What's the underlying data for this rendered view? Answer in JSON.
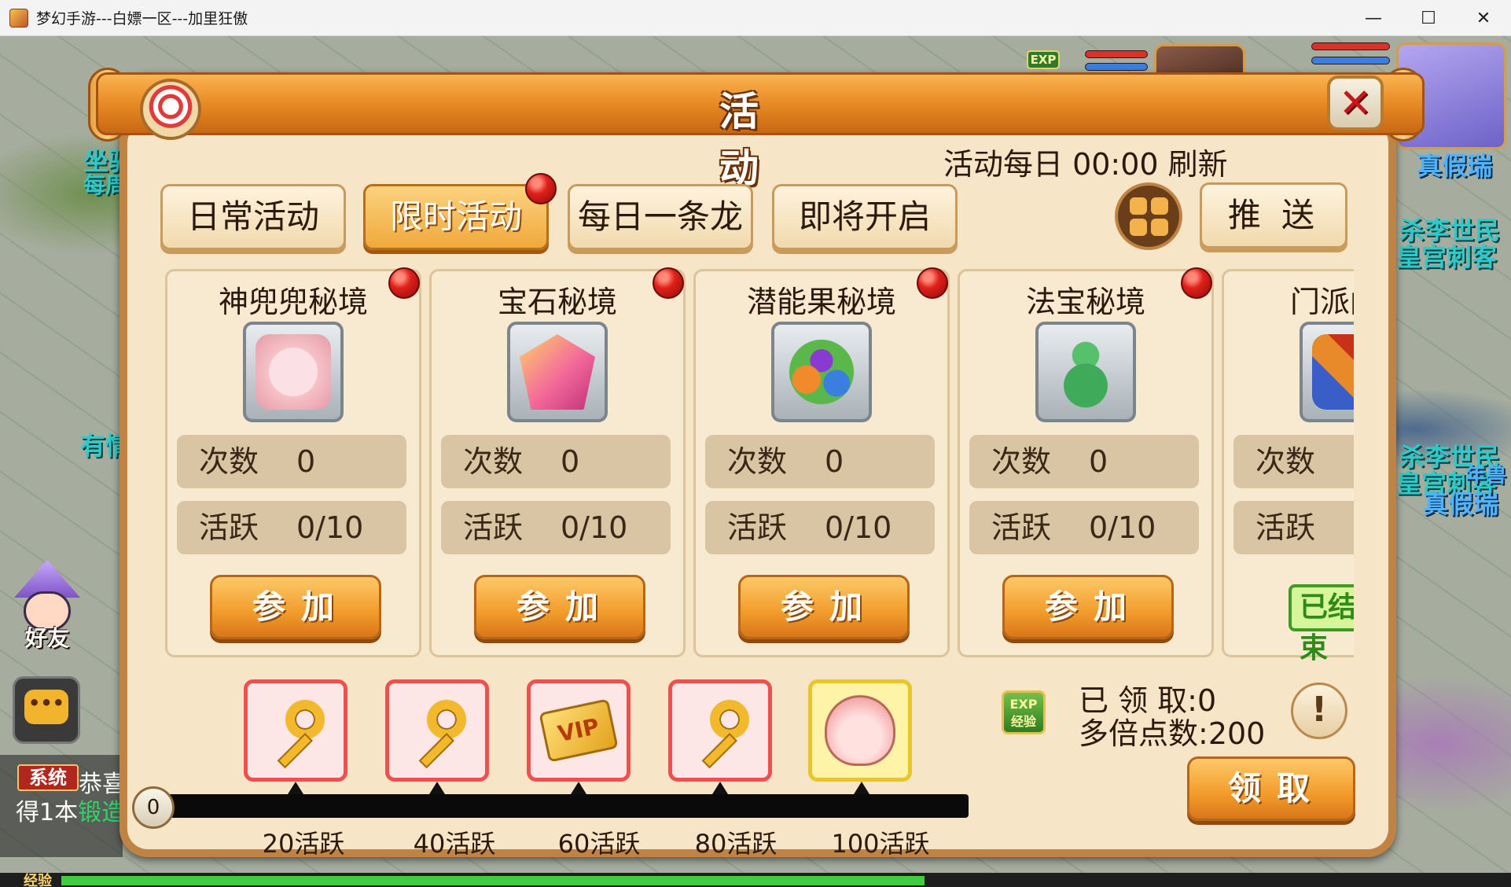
{
  "window": {
    "title": "梦幻手游---白嫖一区---加里狂傲",
    "minimize": "—",
    "maximize": "☐",
    "close": "✕"
  },
  "background": {
    "left_texts": [
      "坐骑",
      "每周",
      "有情"
    ],
    "right_texts": [
      "真假瑞",
      "杀李世民",
      "皇宫刺客",
      "杀李世民",
      "皇宫刺客",
      "真假瑞",
      "年兽"
    ],
    "exp_badge": "EXP",
    "friend_label": "好友",
    "chat_icon": "•••",
    "system_tag": "系统",
    "chat_line1": "恭喜",
    "chat_line2_prefix": "得1本",
    "chat_line2_highlight": "锻造",
    "exp_bar_label": "经验",
    "exp_fraction": 0.6
  },
  "panel": {
    "title": "活 动",
    "refresh_note": "活动每日 00:00 刷新",
    "close_icon": "✕",
    "tabs": [
      {
        "label": "日常活动",
        "active": false,
        "dot": false
      },
      {
        "label": "限时活动",
        "active": true,
        "dot": true
      },
      {
        "label": "每日一条龙",
        "active": false,
        "dot": false
      },
      {
        "label": "即将开启",
        "active": false,
        "dot": false
      }
    ],
    "push_label": "推送"
  },
  "activities": [
    {
      "name": "神兜兜秘境",
      "count_label": "次数",
      "count": "0",
      "active_label": "活跃",
      "active": "0/10",
      "button": "参加",
      "icon": "piggy-bag-icon",
      "icon_color": "#f6c2c8",
      "dot": true
    },
    {
      "name": "宝石秘境",
      "count_label": "次数",
      "count": "0",
      "active_label": "活跃",
      "active": "0/10",
      "button": "参加",
      "icon": "gem-icon",
      "icon_color": "#f36a9a",
      "dot": true
    },
    {
      "name": "潜能果秘境",
      "count_label": "次数",
      "count": "0",
      "active_label": "活跃",
      "active": "0/10",
      "button": "参加",
      "icon": "fruit-icon",
      "icon_color": "#f08a2a",
      "dot": true
    },
    {
      "name": "法宝秘境",
      "count_label": "次数",
      "count": "0",
      "active_label": "活跃",
      "active": "0/10",
      "button": "参加",
      "icon": "gourd-icon",
      "icon_color": "#3faa5a",
      "dot": true
    },
    {
      "name": "门派闯关",
      "count_label": "次数",
      "count": "",
      "active_label": "活跃",
      "active": "",
      "button": "已结束",
      "icon": "sword-icon",
      "icon_color": "#e98a2a",
      "dot": false
    }
  ],
  "rewards": {
    "start_value": "0",
    "progress": 0.0,
    "tiers": [
      {
        "label": "20活跃",
        "item": "key-icon"
      },
      {
        "label": "40活跃",
        "item": "key-icon"
      },
      {
        "label": "60活跃",
        "item": "vip-card-icon",
        "text": "VIP"
      },
      {
        "label": "80活跃",
        "item": "key-icon"
      },
      {
        "label": "100活跃",
        "item": "lucky-bag-icon"
      }
    ],
    "exp_icon_text": "EXP 经验",
    "claimed_label": "已 领 取:",
    "claimed_value": "0",
    "multiplier_label": "多倍点数:",
    "multiplier_value": "200",
    "info_icon": "!",
    "claim_button": "领取"
  },
  "colors": {
    "panel_frame": "#c18343",
    "panel_bg": "#f6e5c7",
    "accent_orange": "#f29b2b",
    "alert_red": "#e0201a"
  }
}
